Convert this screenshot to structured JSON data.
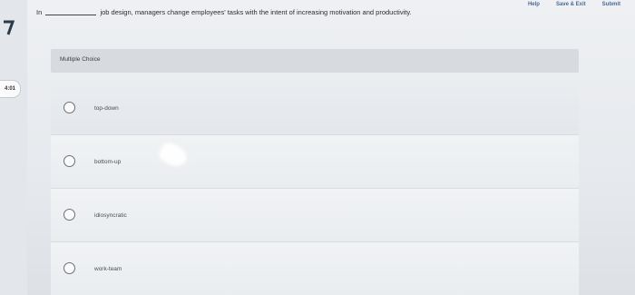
{
  "header": {
    "help_label": "Help",
    "save_exit_label": "Save & Exit",
    "submit_label": "Submit"
  },
  "timer": "4:01",
  "question": {
    "prefix": "In",
    "suffix": "job design, managers change employees' tasks with the intent of increasing motivation and productivity."
  },
  "section_label": "Multiple Choice",
  "options": [
    {
      "label": "top-down"
    },
    {
      "label": "bottom-up"
    },
    {
      "label": "idiosyncratic"
    },
    {
      "label": "work-team"
    }
  ],
  "colors": {
    "link": "#4a6a98",
    "background": "#e9ecef",
    "header_bar": "#d7dbe0"
  }
}
